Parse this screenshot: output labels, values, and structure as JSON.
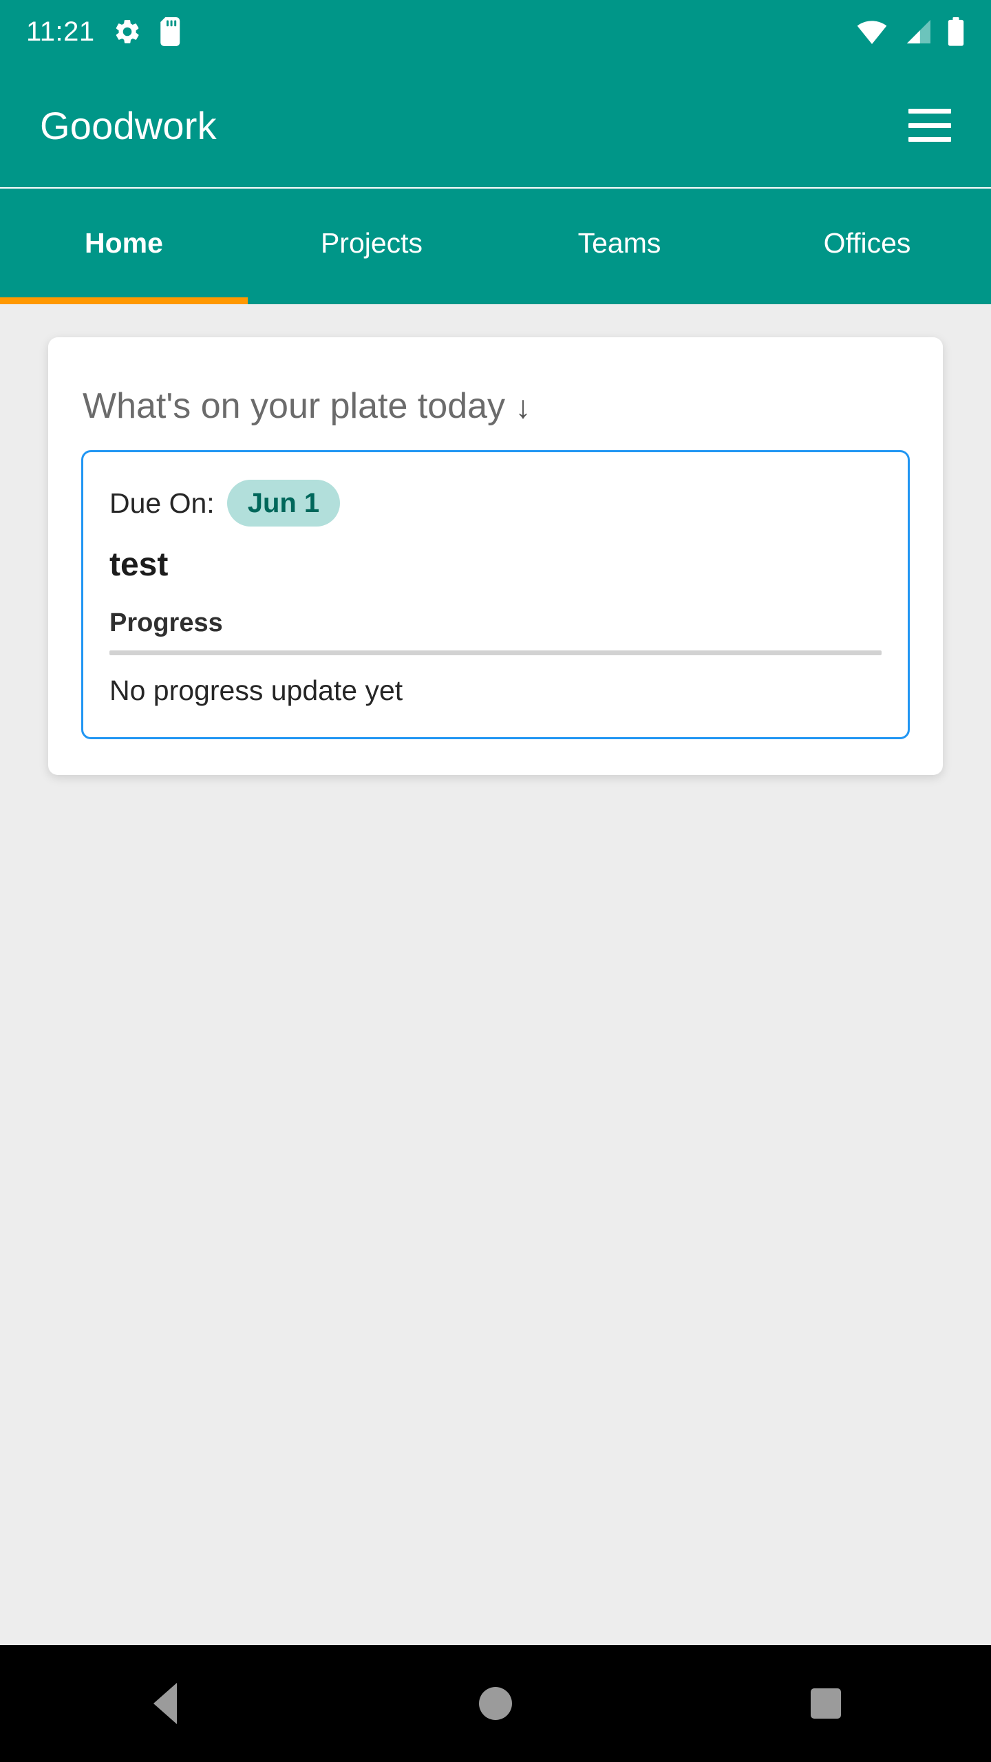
{
  "status_bar": {
    "clock": "11:21",
    "left_icons": [
      "gear-icon",
      "sd-card-icon"
    ],
    "right_icons": [
      "wifi-icon",
      "cellular-signal-icon",
      "battery-icon"
    ],
    "background_color": "#009688"
  },
  "app_bar": {
    "title": "Goodwork",
    "menu_icon": "hamburger-menu-icon",
    "background_color": "#009688"
  },
  "tabs": {
    "items": [
      {
        "label": "Home",
        "active": true
      },
      {
        "label": "Projects",
        "active": false
      },
      {
        "label": "Teams",
        "active": false
      },
      {
        "label": "Offices",
        "active": false
      }
    ],
    "indicator_color": "#ff9800"
  },
  "main": {
    "plate_card": {
      "heading": "What's on your plate today",
      "heading_arrow": "↓",
      "task": {
        "due_label": "Due On:",
        "due_date": "Jun 1",
        "due_badge_bg": "#b2dfdb",
        "due_badge_color": "#00675b",
        "title": "test",
        "progress_label": "Progress",
        "progress_percent": 0,
        "progress_note": "No progress update yet",
        "border_color": "#2196f3"
      }
    }
  },
  "nav_bar": {
    "buttons": [
      "back-button",
      "home-button",
      "recents-button"
    ],
    "background_color": "#000000",
    "icon_color": "#9b9b9b"
  }
}
